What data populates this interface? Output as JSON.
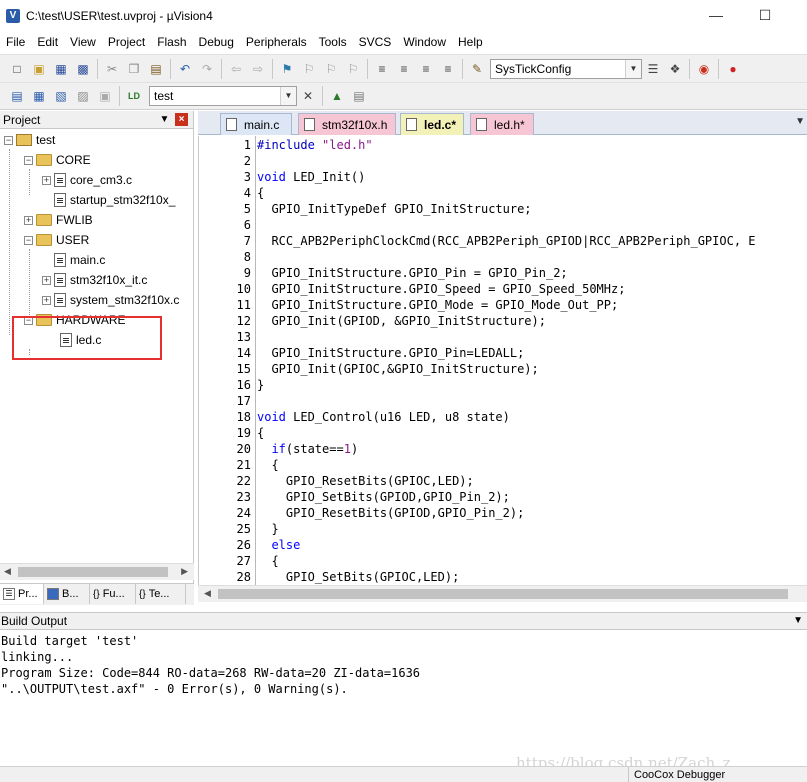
{
  "window": {
    "title": "C:\\test\\USER\\test.uvproj - µVision4",
    "minimize": "—",
    "maximize": "☐"
  },
  "menu": [
    "File",
    "Edit",
    "View",
    "Project",
    "Flash",
    "Debug",
    "Peripherals",
    "Tools",
    "SVCS",
    "Window",
    "Help"
  ],
  "toolbar": {
    "function_combo": "SysTickConfig",
    "target_combo": "test"
  },
  "project_panel": {
    "title": "Project",
    "tree": {
      "root": "test",
      "groups": [
        {
          "name": "CORE",
          "files": [
            "core_cm3.c",
            "startup_stm32f10x_"
          ]
        },
        {
          "name": "FWLIB",
          "files": []
        },
        {
          "name": "USER",
          "files": [
            "main.c",
            "stm32f10x_it.c",
            "system_stm32f10x.c"
          ]
        },
        {
          "name": "HARDWARE",
          "files": [
            "led.c"
          ]
        }
      ]
    },
    "bottom_tabs": [
      "Pr...",
      "B...",
      "Fu...",
      "Te..."
    ],
    "highlight_color": "#e53030"
  },
  "editor_tabs": [
    {
      "label": "main.c",
      "color": "#dce6f5"
    },
    {
      "label": "stm32f10x.h",
      "color": "#f7c6d4"
    },
    {
      "label": "led.c*",
      "color": "#f2f2b8"
    },
    {
      "label": "led.h*",
      "color": "#f7c6d4"
    }
  ],
  "code": [
    "#include \"led.h\"",
    "",
    "void LED_Init()",
    "{",
    "  GPIO_InitTypeDef GPIO_InitStructure;",
    "",
    "  RCC_APB2PeriphClockCmd(RCC_APB2Periph_GPIOD|RCC_APB2Periph_GPIOC, E",
    "",
    "  GPIO_InitStructure.GPIO_Pin = GPIO_Pin_2;",
    "  GPIO_InitStructure.GPIO_Speed = GPIO_Speed_50MHz;",
    "  GPIO_InitStructure.GPIO_Mode = GPIO_Mode_Out_PP;",
    "  GPIO_Init(GPIOD, &GPIO_InitStructure);",
    "",
    "  GPIO_InitStructure.GPIO_Pin=LEDALL;",
    "  GPIO_Init(GPIOC,&GPIO_InitStructure);",
    "}",
    "",
    "void LED_Control(u16 LED, u8 state)",
    "{",
    "  if(state==1)",
    "  {",
    "    GPIO_ResetBits(GPIOC,LED);",
    "    GPIO_SetBits(GPIOD,GPIO_Pin_2);",
    "    GPIO_ResetBits(GPIOD,GPIO_Pin_2);",
    "  }",
    "  else",
    "  {",
    "    GPIO_SetBits(GPIOC,LED);"
  ],
  "build_output": {
    "title": "Build Output",
    "lines": [
      "Build target 'test'",
      "linking...",
      "Program Size: Code=844 RO-data=268 RW-data=20 ZI-data=1636",
      "\"..\\OUTPUT\\test.axf\" - 0 Error(s), 0 Warning(s)."
    ]
  },
  "watermark": "https://blog.csdn.net/Zach_z",
  "status": {
    "debugger": "CooCox Debugger"
  }
}
